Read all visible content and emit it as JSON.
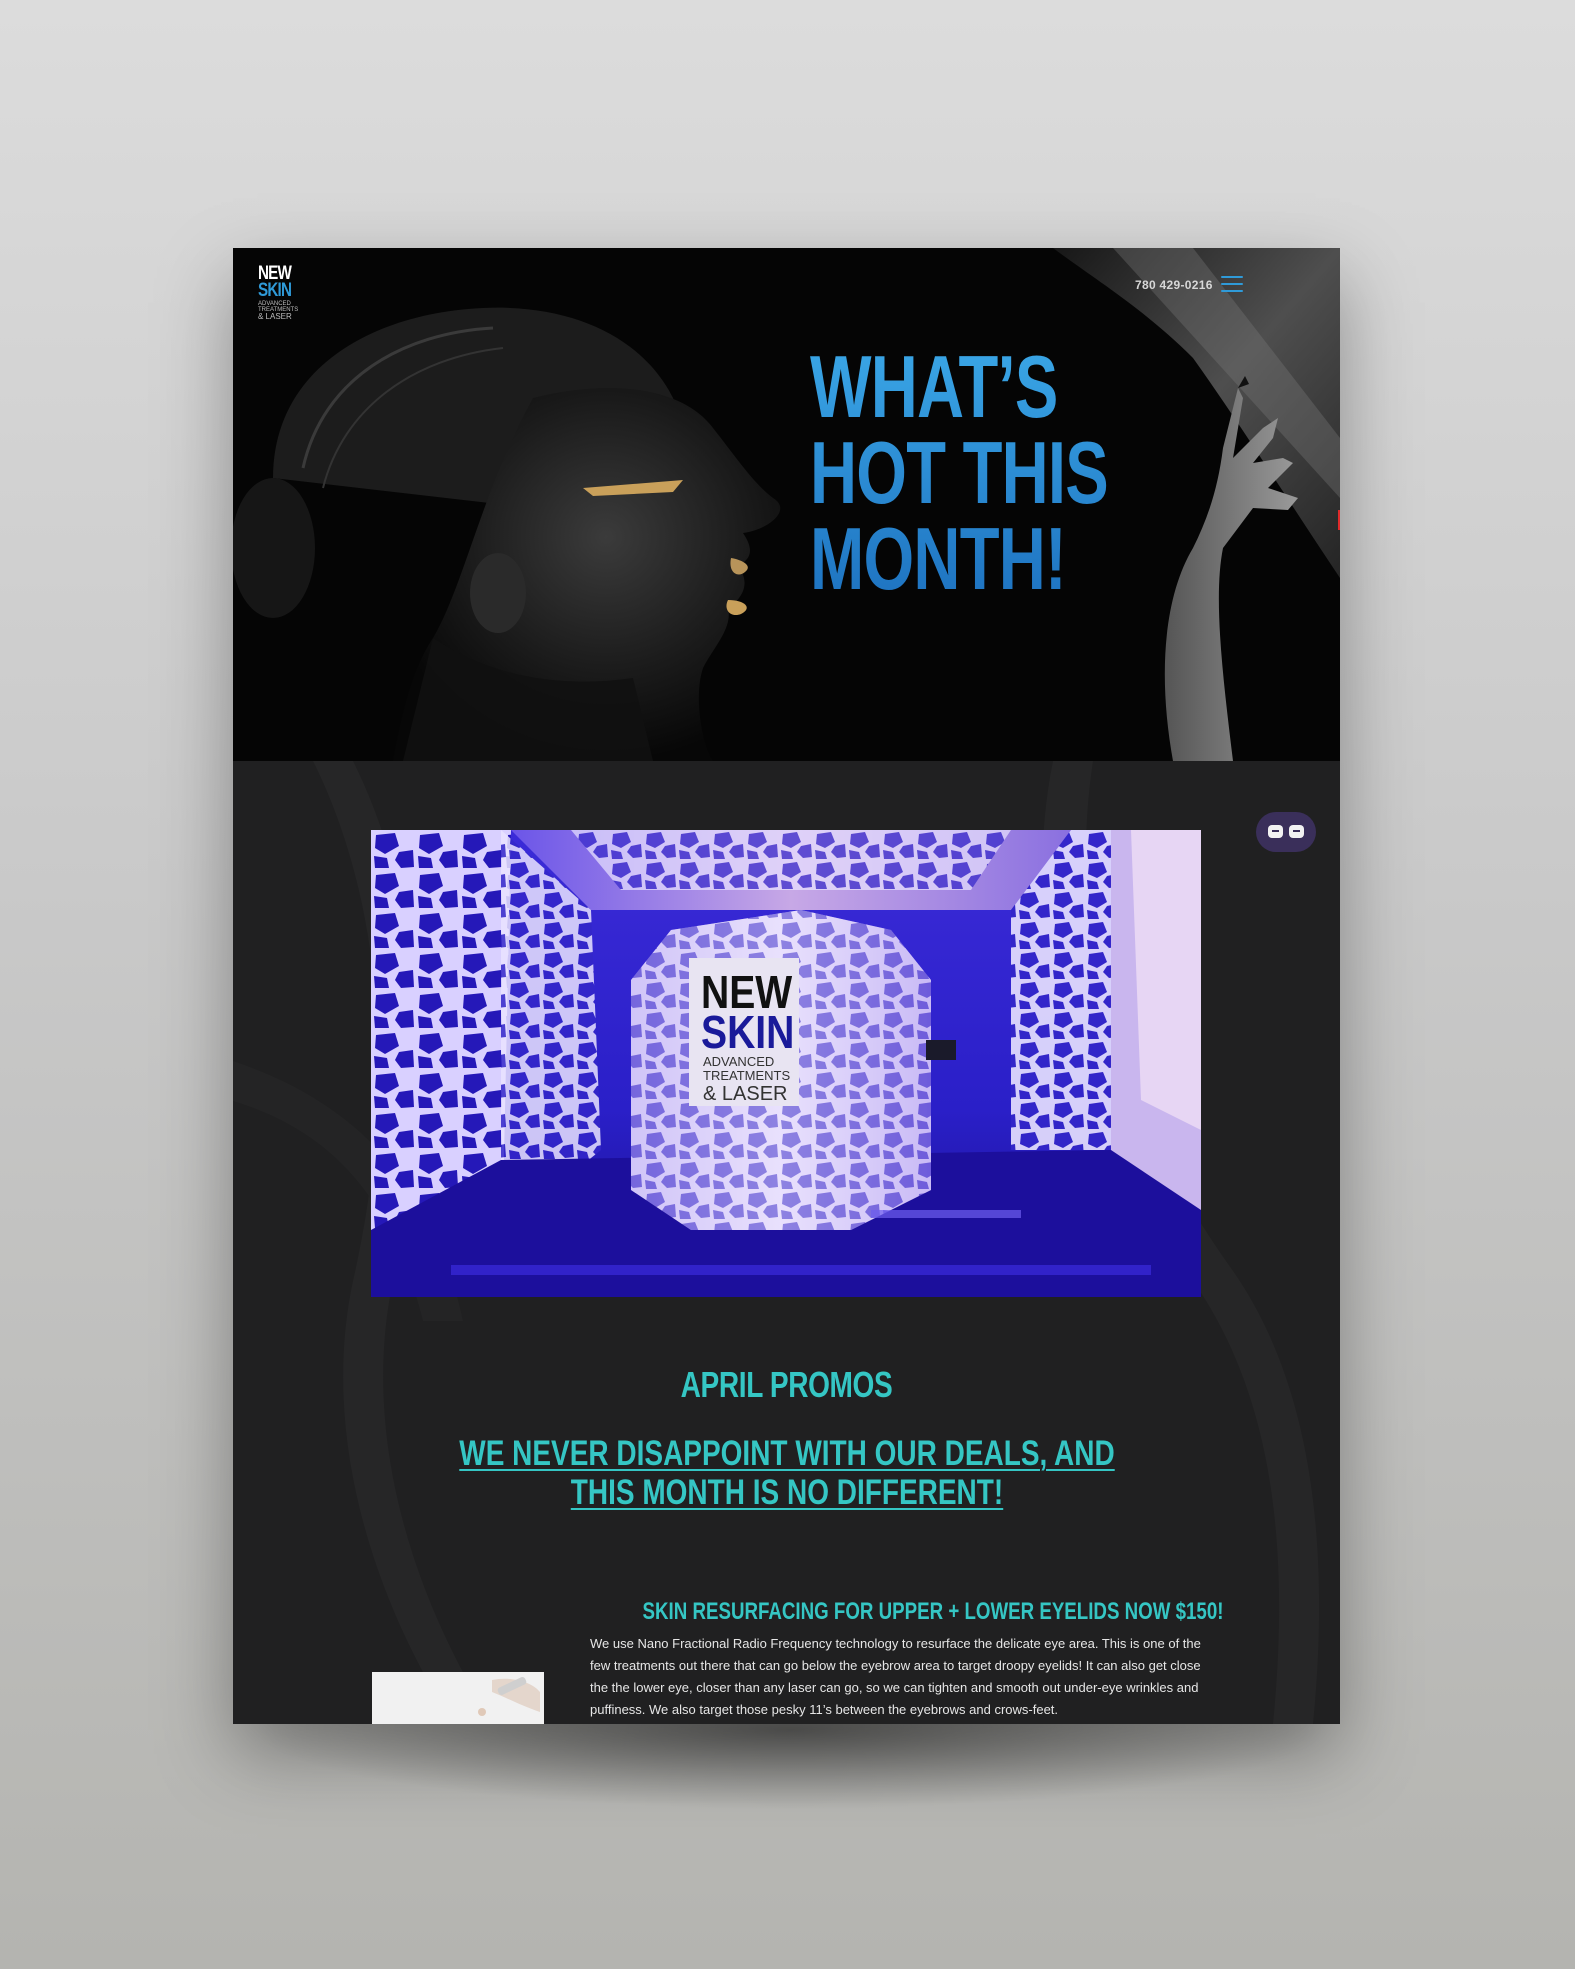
{
  "header": {
    "logo": {
      "line1": "NEW",
      "line2": "SKIN",
      "line3": "ADVANCED TREATMENTS",
      "line4": "& LASER"
    },
    "phone": "780 429-0216",
    "menu_icon": "hamburger-icon",
    "accent_color": "#2f9ad8"
  },
  "hero": {
    "title": "WHAT’S\nHOT THIS\nMONTH!"
  },
  "photo_sign": {
    "line1": "NEW",
    "line2": "SKIN",
    "line3": "ADVANCED",
    "line4": "TREATMENTS",
    "line5": "& LASER"
  },
  "chat": {
    "icon": "chat-bubbles-icon"
  },
  "promos": {
    "title": "APRIL PROMOS",
    "subtitle": "WE NEVER DISAPPOINT WITH OUR DEALS, AND THIS MONTH IS NO DIFFERENT!",
    "accent_color": "#35c6c4"
  },
  "offer": {
    "title": "SKIN RESURFACING FOR UPPER + LOWER EYELIDS NOW $150!",
    "body": "We use Nano Fractional Radio Frequency technology to resurface the delicate eye area. This is one of the few treatments out there that can go below the eyebrow area to target droopy eyelids! It can also get close the the lower eye, closer than any laser can go, so we can tighten and smooth out under-eye wrinkles and puffiness. We also target those pesky 11’s between the eyebrows and crows-feet."
  }
}
